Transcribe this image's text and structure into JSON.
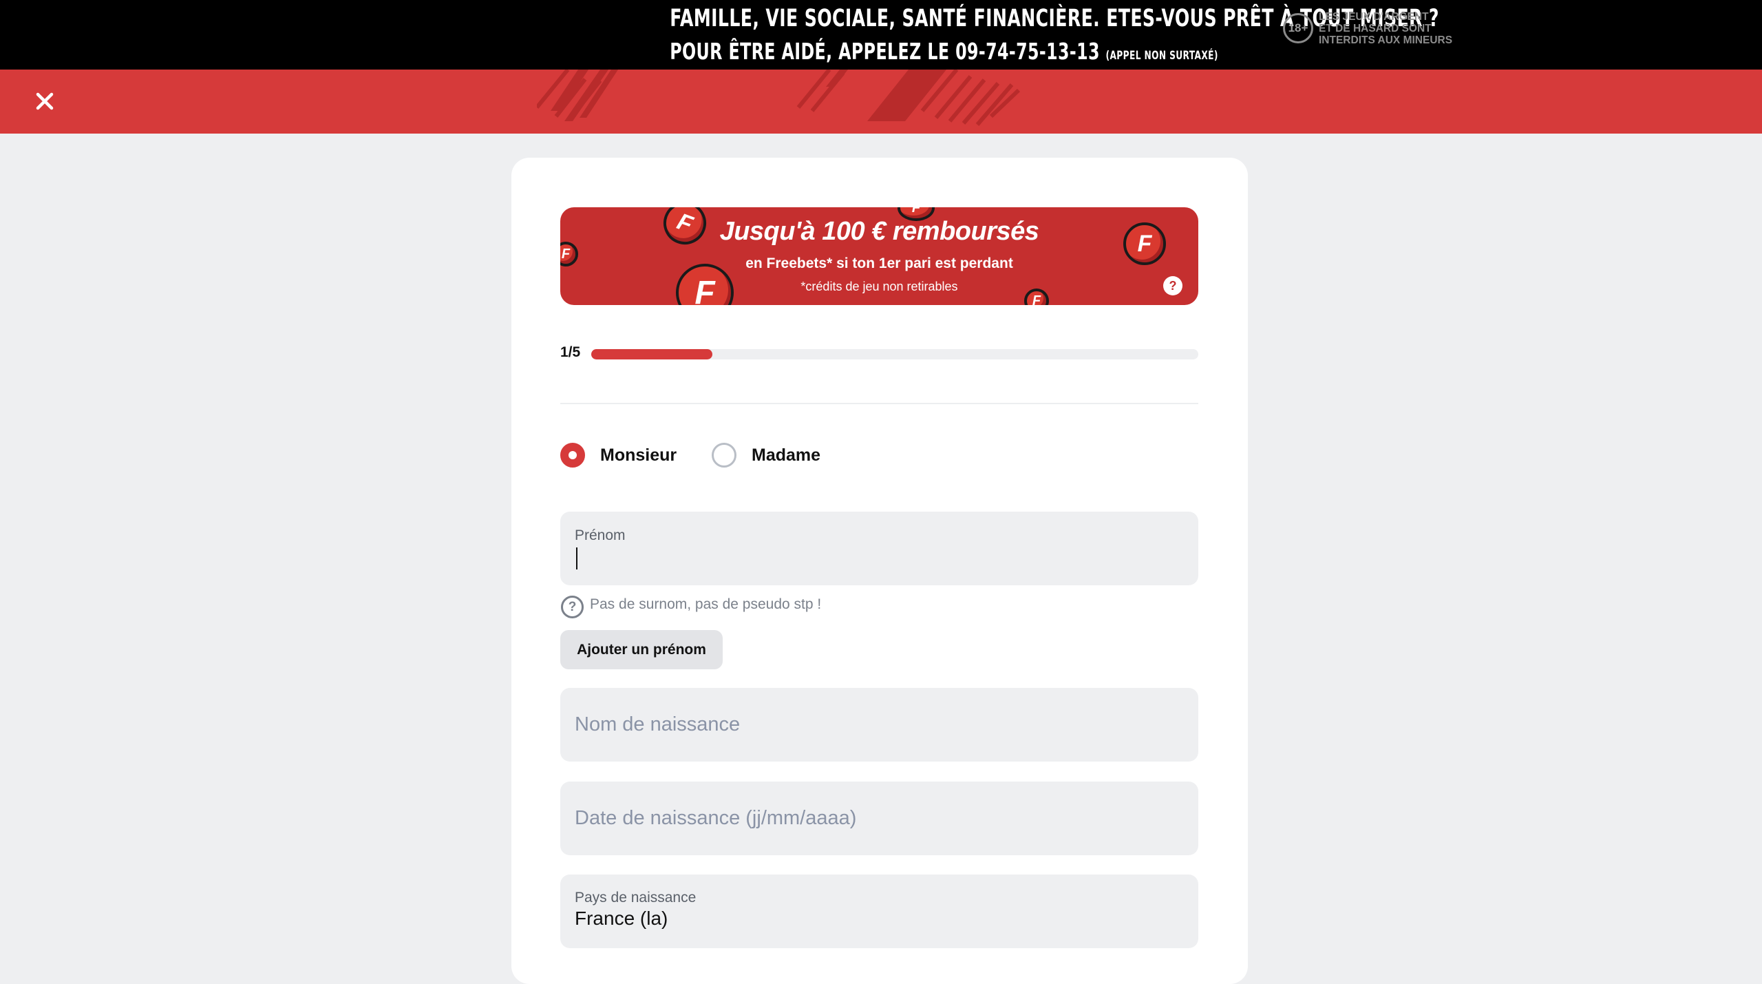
{
  "warning_banner": {
    "line1": "FAMILLE, VIE SOCIALE, SANTÉ FINANCIÈRE. ETES-VOUS PRÊT À TOUT MISER ?",
    "line2": "POUR ÊTRE AIDÉ, APPELEZ LE 09-74-75-13-13",
    "line2_small": "(APPEL NON SURTAXÉ)",
    "age_badge": "18+",
    "age_text_1": "LES JEUX D'ARGENT",
    "age_text_2": "ET DE HASARD SONT",
    "age_text_3": "INTERDITS AUX MINEURS"
  },
  "header": {
    "close_icon": "close-icon"
  },
  "promo": {
    "title": "Jusqu'à 100 € remboursés",
    "subtitle": "en Freebets* si ton 1er pari est perdant",
    "note": "*crédits de jeu non retirables",
    "coin_letter": "F",
    "help": "?"
  },
  "progress": {
    "step_label": "1/5",
    "current": 1,
    "total": 5
  },
  "gender": {
    "options": [
      {
        "label": "Monsieur",
        "selected": true
      },
      {
        "label": "Madame",
        "selected": false
      }
    ]
  },
  "form": {
    "first_name": {
      "label": "Prénom",
      "value": ""
    },
    "hint": {
      "icon": "?",
      "text": "Pas de surnom, pas de pseudo stp !"
    },
    "add_first_name_label": "Ajouter un prénom",
    "birth_name": {
      "placeholder": "Nom de naissance"
    },
    "birth_date": {
      "placeholder": "Date de naissance (jj/mm/aaaa)"
    },
    "birth_country": {
      "label": "Pays de naissance",
      "value": "France (la)"
    }
  },
  "colors": {
    "brand_red": "#d63a3a",
    "promo_red": "#c52f2f",
    "field_bg": "#eeeff1"
  }
}
